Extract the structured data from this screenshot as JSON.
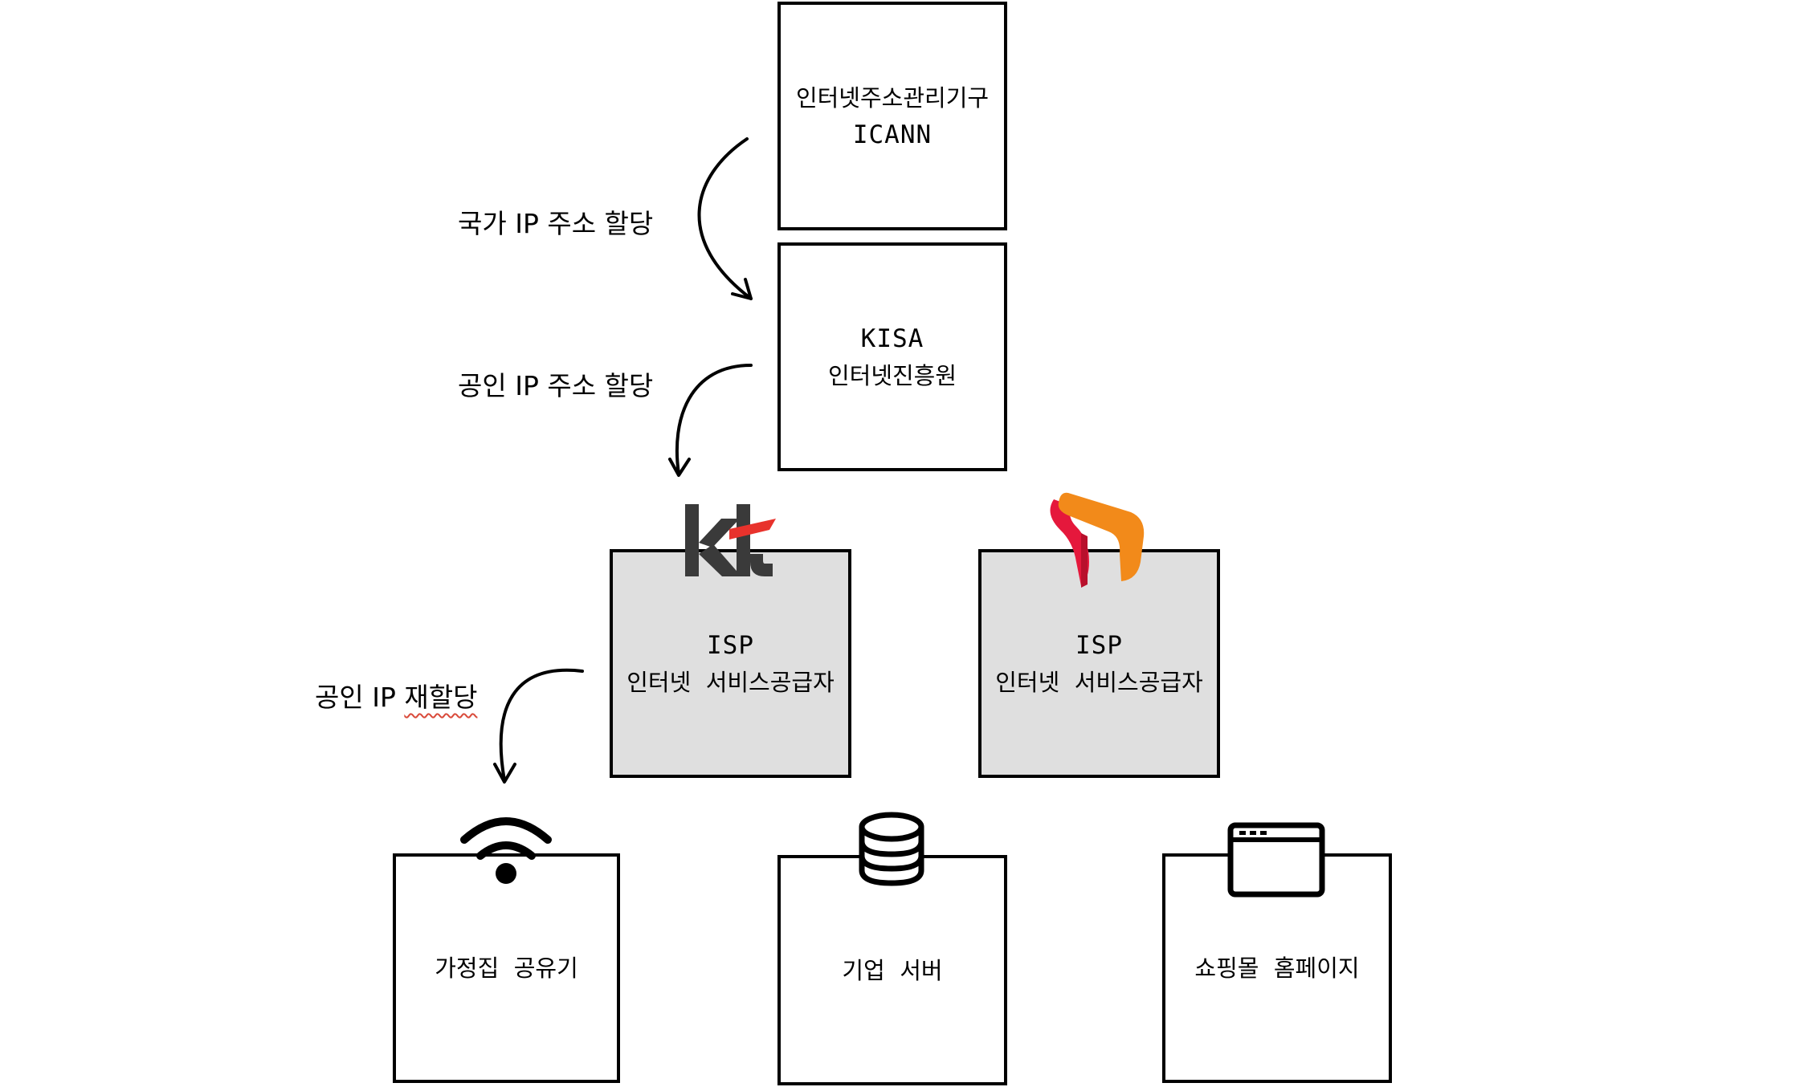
{
  "nodes": {
    "icann": {
      "line1": "인터넷주소관리기구",
      "line2": "ICANN"
    },
    "kisa": {
      "line1": "KISA",
      "line2": "인터넷진흥원"
    },
    "isp_kt": {
      "line1": "ISP",
      "line2": "인터넷  서비스공급자",
      "logo": "kt"
    },
    "isp_skt": {
      "line1": "ISP",
      "line2": "인터넷  서비스공급자"
    },
    "home_router": {
      "label": "가정집  공유기",
      "icon": "wifi-icon"
    },
    "corp_server": {
      "label": "기업  서버",
      "icon": "database-icon"
    },
    "shop_site": {
      "label": "쇼핑몰  홈페이지",
      "icon": "browser-window-icon"
    }
  },
  "edges": {
    "national": {
      "label": "국가 IP 주소 할당"
    },
    "public": {
      "label": "공인 IP 주소 할당"
    },
    "reassign": {
      "label_prefix": "공인 IP ",
      "label_suffix": "재할당"
    }
  },
  "colors": {
    "isp_fill": "#dfdfdf",
    "kt_red": "#e8322c",
    "kt_dark": "#3a3a3a",
    "skt_red": "#e5183c",
    "skt_orange": "#f28a1a",
    "spellcheck_underline": "#d94a3a"
  }
}
